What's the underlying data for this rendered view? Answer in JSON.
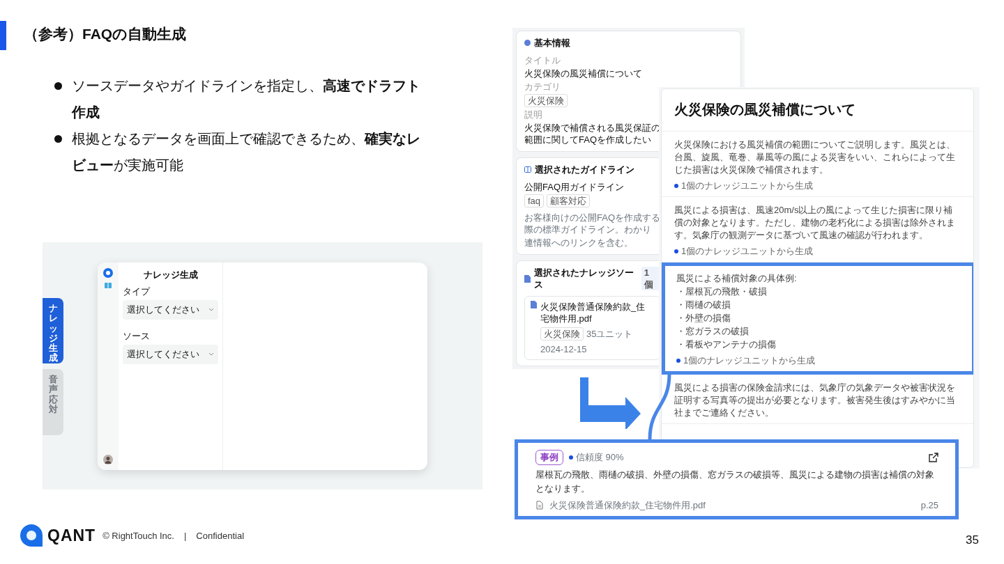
{
  "slide": {
    "title": "（参考）FAQの自動生成",
    "bullets": [
      "ソースデータやガイドラインを指定し、**高速でドラフト作成**",
      "根拠となるデータを画面上で確認できるため、**確実なレビュー**が実施可能"
    ]
  },
  "app_preview": {
    "tabs": [
      {
        "label": "ナレッジ生成",
        "selected": true
      },
      {
        "label": "音声応対",
        "selected": false
      }
    ],
    "panel_title": "ナレッジ生成",
    "fields": [
      {
        "label": "タイプ",
        "placeholder": "選択してください"
      },
      {
        "label": "ソース",
        "placeholder": "選択してください"
      }
    ]
  },
  "settings_panel": {
    "basic_info": {
      "heading": "基本情報",
      "title_label": "タイトル",
      "title": "火災保険の風災補償について",
      "category_label": "カテゴリ",
      "category": "火災保険",
      "description_label": "説明",
      "description": "火災保険で補償される風災保証の範囲に関してFAQを作成したい"
    },
    "guideline": {
      "heading": "選択されたガイドライン",
      "name": "公開FAQ用ガイドライン",
      "tags": [
        "faq",
        "顧客対応"
      ],
      "description_lines": [
        "お客様向けの公開FAQを作成する際の標準ガイドライン。わかり",
        "連情報へのリンクを含む。"
      ]
    },
    "knowledge_sources": {
      "heading": "選択されたナレッジソース",
      "count": "1個",
      "files": [
        {
          "name": "火災保険普通保険約款_住宅物件用.pdf",
          "tag": "火災保険",
          "units": "35ユニット",
          "date": "2024-12-15"
        }
      ]
    }
  },
  "faq_card": {
    "title": "火災保険の風災補償について",
    "sections": [
      {
        "kind": "paragraph",
        "highlighted": false,
        "text": "火災保険における風災補償の範囲についてご説明します。風災とは、台風、旋風、竜巻、暴風等の風による災害をいい、これらによって生じた損害は火災保険で補償されます。",
        "source": "1個のナレッジユニットから生成"
      },
      {
        "kind": "paragraph",
        "highlighted": false,
        "text": "風災による損害は、風速20m/s以上の風によって生じた損害に限り補償の対象となります。ただし、建物の老朽化による損害は除外されます。気象庁の観測データに基づいて風速の確認が行われます。",
        "source": "1個のナレッジユニットから生成"
      },
      {
        "kind": "list",
        "highlighted": true,
        "intro": "風災による補償対象の具体例:",
        "items": [
          "・屋根瓦の飛散・破損",
          "・雨樋の破損",
          "・外壁の損傷",
          "・窓ガラスの破損",
          "・看板やアンテナの損傷"
        ],
        "source": "1個のナレッジユニットから生成"
      },
      {
        "kind": "paragraph",
        "highlighted": false,
        "text": "風災による損害の保険金請求には、気象庁の気象データや被害状況を証明する写真等の提出が必要となります。被害発生後はすみやかに当社までご連絡ください。"
      }
    ]
  },
  "evidence_popup": {
    "tag": "事例",
    "confidence": "信頼度 90%",
    "text": "屋根瓦の飛散、雨樋の破損、外壁の損傷、窓ガラスの破損等、風災による建物の損害は補償の対象となります。",
    "file": "火災保険普通保険約款_住宅物件用.pdf",
    "page": "p.25"
  },
  "footer": {
    "logo_text": "QANT",
    "copyright": "© RightTouch Inc.",
    "separator": "|",
    "confidential": "Confidential",
    "page_number": "35"
  }
}
